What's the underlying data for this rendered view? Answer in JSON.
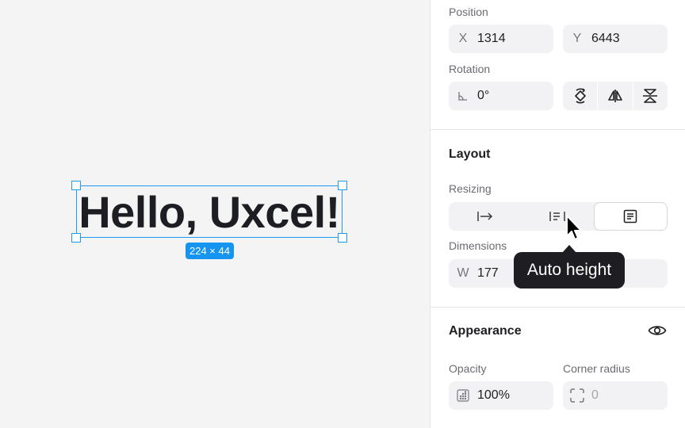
{
  "canvas": {
    "text": "Hello, Uxcel!",
    "size_badge": "224 × 44"
  },
  "panel": {
    "position": {
      "label": "Position",
      "x_prefix": "X",
      "x_value": "1314",
      "y_prefix": "Y",
      "y_value": "6443"
    },
    "rotation": {
      "label": "Rotation",
      "value": "0°",
      "buttons": [
        "rotate-icon",
        "flip-horizontal-icon",
        "flip-vertical-icon"
      ]
    },
    "layout": {
      "heading": "Layout",
      "resizing_label": "Resizing",
      "resizing_options": [
        "auto-width-icon",
        "auto-height-icon",
        "fixed-size-icon"
      ],
      "dimensions_label": "Dimensions",
      "w_prefix": "W",
      "w_value": "177"
    },
    "appearance": {
      "heading": "Appearance",
      "opacity_label": "Opacity",
      "opacity_value": "100%",
      "corner_radius_label": "Corner radius",
      "corner_radius_value": "0"
    }
  },
  "tooltip": {
    "text": "Auto height"
  },
  "colors": {
    "selection": "#1e9bf0",
    "badge": "#1594f0",
    "tooltip": "#1e1e22"
  }
}
